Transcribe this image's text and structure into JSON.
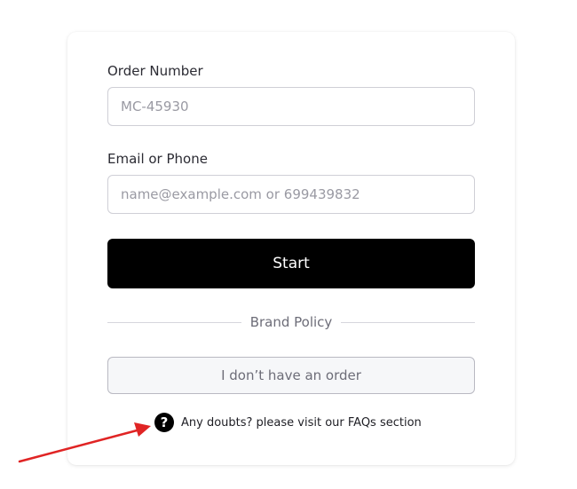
{
  "form": {
    "order_label": "Order Number",
    "order_placeholder": "MC-45930",
    "contact_label": "Email or Phone",
    "contact_placeholder": "name@example.com or 699439832",
    "start_label": "Start",
    "divider_text": "Brand Policy",
    "no_order_label": "I don’t have an order",
    "faq_text": "Any doubts? please visit our FAQs section",
    "faq_icon": "?"
  },
  "colors": {
    "primary_button": "#000000",
    "annotation_arrow": "#e02424"
  },
  "annotation": {
    "icon": "red-arrow-icon"
  }
}
